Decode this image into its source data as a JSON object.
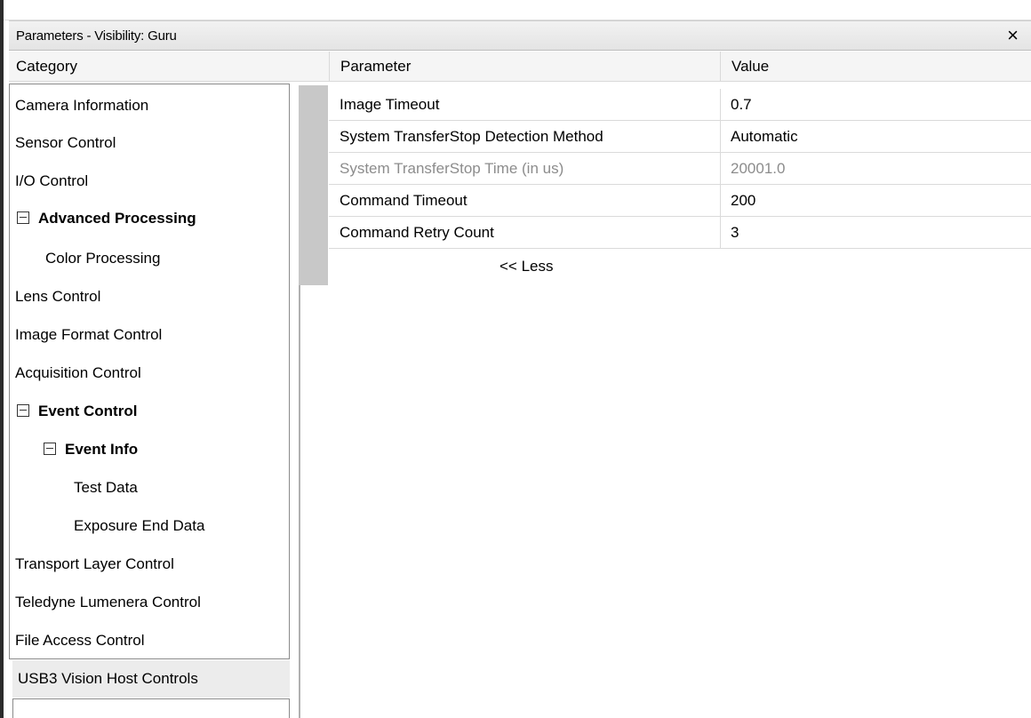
{
  "window": {
    "title": "Parameters - Visibility: Guru",
    "close_glyph": "×"
  },
  "headers": {
    "category": "Category",
    "parameter": "Parameter",
    "value": "Value"
  },
  "categories": [
    {
      "label": "Camera Information",
      "bold": false,
      "expanded": null
    },
    {
      "label": "Sensor Control",
      "bold": false,
      "expanded": null
    },
    {
      "label": "I/O Control",
      "bold": false,
      "expanded": null
    },
    {
      "label": "Advanced Processing",
      "bold": true,
      "expanded": true
    },
    {
      "label": "Color Processing",
      "bold": false,
      "expanded": null
    },
    {
      "label": "Lens Control",
      "bold": false,
      "expanded": null
    },
    {
      "label": "Image Format Control",
      "bold": false,
      "expanded": null
    },
    {
      "label": "Acquisition Control",
      "bold": false,
      "expanded": null
    },
    {
      "label": "Event Control",
      "bold": true,
      "expanded": true
    },
    {
      "label": "Event Info",
      "bold": true,
      "expanded": true
    },
    {
      "label": "Test Data",
      "bold": false,
      "expanded": null
    },
    {
      "label": "Exposure End Data",
      "bold": false,
      "expanded": null
    },
    {
      "label": "Transport Layer Control",
      "bold": false,
      "expanded": null
    },
    {
      "label": "Teledyne Lumenera Control",
      "bold": false,
      "expanded": null
    },
    {
      "label": "File Access Control",
      "bold": false,
      "expanded": null
    }
  ],
  "selected_category": "USB3 Vision Host Controls",
  "parameters": [
    {
      "name": "Image Timeout",
      "value": "0.7",
      "disabled": false
    },
    {
      "name": "System TransferStop Detection Method",
      "value": "Automatic",
      "disabled": false
    },
    {
      "name": "System TransferStop Time (in us)",
      "value": "20001.0",
      "disabled": true
    },
    {
      "name": "Command Timeout",
      "value": "200",
      "disabled": false
    },
    {
      "name": "Command Retry Count",
      "value": "3",
      "disabled": false
    }
  ],
  "less_button": "<< Less"
}
